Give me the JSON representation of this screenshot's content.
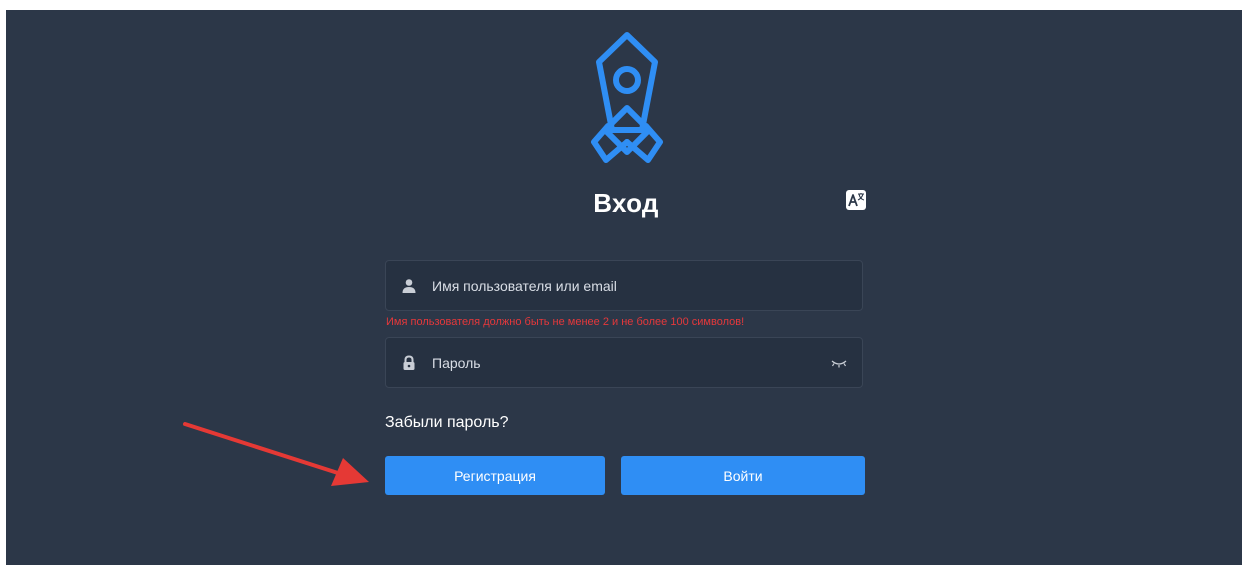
{
  "page": {
    "title": "Вход"
  },
  "login_form": {
    "username": {
      "value": "",
      "placeholder": "Имя пользователя или email",
      "error": "Имя пользователя должно быть не менее 2 и не более 100 символов!"
    },
    "password": {
      "value": "",
      "placeholder": "Пароль"
    },
    "forgot_password_label": "Забыли пароль?",
    "register_label": "Регистрация",
    "login_label": "Войти"
  },
  "icons": {
    "logo": "rocket-logo",
    "language": "translate-icon",
    "username": "user-icon",
    "password": "lock-icon",
    "password_toggle": "eye-closed-icon",
    "annotation": "red-arrow"
  },
  "colors": {
    "background": "#2c3748",
    "input_background": "#263141",
    "accent": "#2f8ef4",
    "logo": "#2f8ef4",
    "error": "#e5383b",
    "annotation_arrow": "#e53935"
  }
}
